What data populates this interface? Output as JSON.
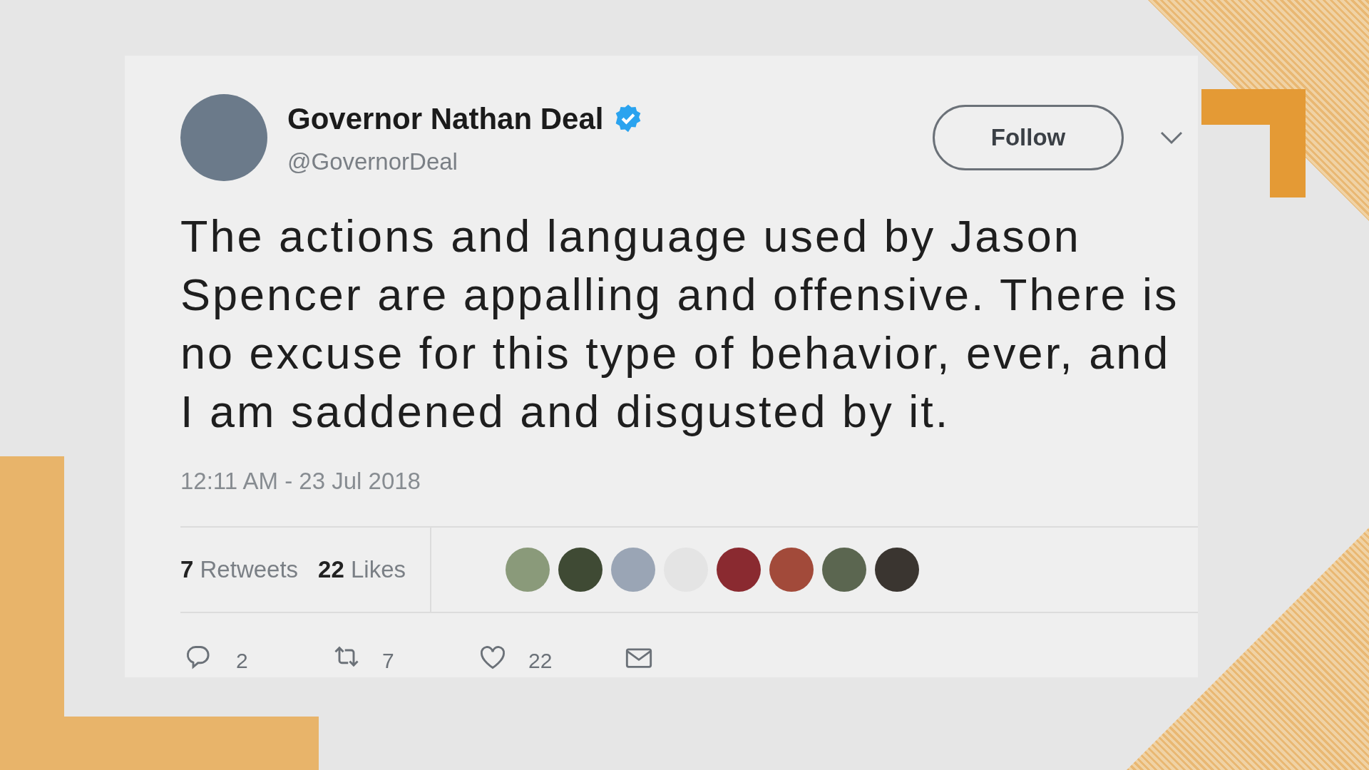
{
  "tweet": {
    "name": "Governor Nathan Deal",
    "verified": true,
    "handle": "@GovernorDeal",
    "follow_label": "Follow",
    "text": "The actions and language used by Jason Spencer are appalling and offensive. There is no excuse for this type of behavior, ever, and I am saddened and disgusted by it.",
    "timestamp": "12:11 AM - 23 Jul 2018",
    "stats": [
      {
        "count": "7",
        "label": "Retweets"
      },
      {
        "count": "22",
        "label": "Likes"
      }
    ],
    "actions": [
      {
        "kind": "reply",
        "count": "2"
      },
      {
        "kind": "retweet",
        "count": "7"
      },
      {
        "kind": "like",
        "count": "22"
      },
      {
        "kind": "message"
      }
    ]
  }
}
